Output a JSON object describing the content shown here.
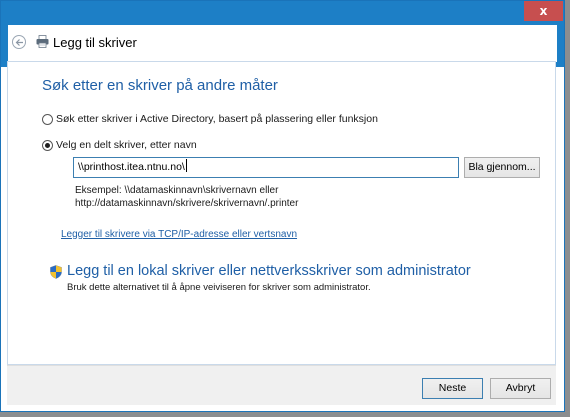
{
  "window": {
    "title": "Legg til skriver",
    "close_label": "x"
  },
  "content": {
    "heading": "Søk etter en skriver på andre måter",
    "options": [
      {
        "label": "Søk etter skriver i Active Directory, basert på plassering eller funksjon",
        "selected": false
      },
      {
        "label": "Velg en delt skriver, etter navn",
        "selected": true
      }
    ],
    "printer_name_input": {
      "value": "\\\\printhost.itea.ntnu.no\\"
    },
    "browse_label": "Bla gjennom...",
    "example_line1": "Eksempel: \\\\datamaskinnavn\\skrivernavn eller",
    "example_line2": "http://datamaskinnavn/skrivere/skrivernavn/.printer",
    "tcp_link": "Legger til skrivere via TCP/IP-adresse eller vertsnavn",
    "admin_title": "Legg til en lokal skriver eller nettverksskriver som administrator",
    "admin_desc": "Bruk dette alternativet til å åpne veiviseren for skriver som administrator."
  },
  "footer": {
    "next_label": "Neste",
    "cancel_label": "Avbryt"
  },
  "colors": {
    "titlebar": "#1d7fc6",
    "accent_text": "#1f5fa6",
    "close_button": "#c74f4f"
  }
}
